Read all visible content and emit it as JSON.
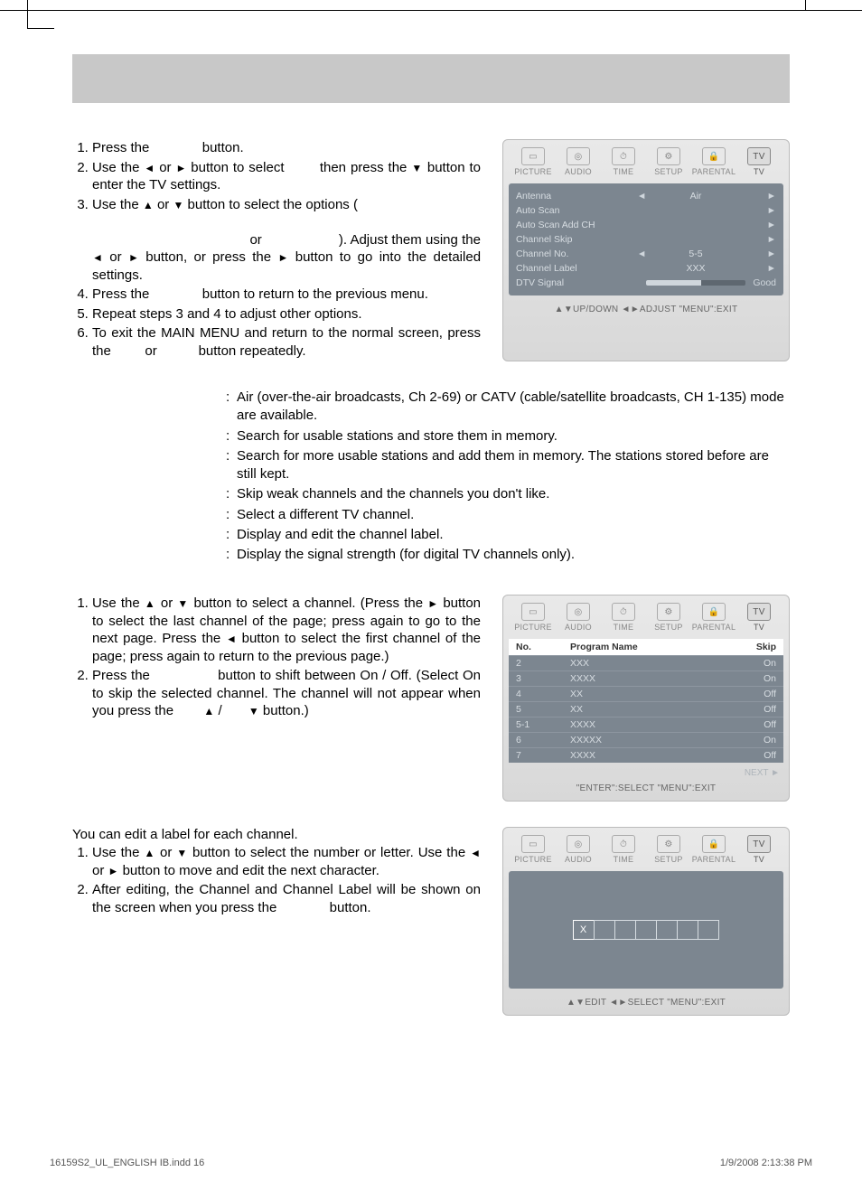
{
  "steps_a": {
    "s1a": "Press the",
    "s1b": "button.",
    "s2a": "Use the",
    "s2b": "or",
    "s2c": "button to select",
    "s2d": "then press the",
    "s2e": "button to enter the TV settings.",
    "s3a": "Use the",
    "s3b": "or",
    "s3c": "button to select the options (",
    "s3d": "or",
    "s3e": "). Adjust them using the",
    "s3f": "or",
    "s3g": "button, or press the",
    "s3h": "button to go into the detailed settings.",
    "s4a": "Press the",
    "s4b": "button to return to the previous menu.",
    "s5": "Repeat steps 3 and 4 to adjust other options.",
    "s6a": "To exit the MAIN MENU and return to the normal screen, press the",
    "s6b": "or",
    "s6c": "button repeatedly."
  },
  "osd1": {
    "tabs": [
      "PICTURE",
      "AUDIO",
      "TIME",
      "SETUP",
      "PARENTAL",
      "TV"
    ],
    "rows": [
      {
        "label": "Antenna",
        "left": "◄",
        "value": "Air",
        "right": "►"
      },
      {
        "label": "Auto Scan",
        "left": "",
        "value": "",
        "right": "►"
      },
      {
        "label": "Auto Scan Add CH",
        "left": "",
        "value": "",
        "right": "►"
      },
      {
        "label": "Channel Skip",
        "left": "",
        "value": "",
        "right": "►"
      },
      {
        "label": "Channel No.",
        "left": "◄",
        "value": "5-5",
        "right": "►"
      },
      {
        "label": "Channel Label",
        "left": "",
        "value": "XXX",
        "right": "►"
      },
      {
        "label": "DTV Signal",
        "left": "",
        "value": "__bar__",
        "right": "Good"
      }
    ],
    "foot": "▲▼UP/DOWN  ◄►ADJUST  \"MENU\":EXIT"
  },
  "defs": [
    "Air (over-the-air broadcasts, Ch 2-69) or CATV (cable/satellite broadcasts, CH 1-135) mode are available.",
    "Search for usable stations and store them in memory.",
    "Search for more usable stations and add them in memory. The stations stored before are still kept.",
    "Skip weak channels and the channels you don't like.",
    "Select a different TV channel.",
    "Display and edit the channel label.",
    "Display the signal strength (for digital TV channels only)."
  ],
  "steps_b": {
    "s1a": "Use the",
    "s1b": "or",
    "s1c": "button to select a channel. (Press the",
    "s1d": "button to select the last channel of the page; press again to go to the next page. Press the",
    "s1e": "button to select the first channel of the page; press again to return to the previous page.)",
    "s2a": "Press the",
    "s2b": "button to shift between On / Off. (Select On to skip the selected channel. The channel will not appear when you press the",
    "s2c": "/",
    "s2d": "button.)"
  },
  "osd2": {
    "hdr": {
      "no": "No.",
      "pn": "Program Name",
      "sk": "Skip"
    },
    "rows": [
      {
        "no": "2",
        "pn": "XXX",
        "sk": "On"
      },
      {
        "no": "3",
        "pn": "XXXX",
        "sk": "On"
      },
      {
        "no": "4",
        "pn": "XX",
        "sk": "Off"
      },
      {
        "no": "5",
        "pn": "XX",
        "sk": "Off"
      },
      {
        "no": "5-1",
        "pn": "XXXX",
        "sk": "Off"
      },
      {
        "no": "6",
        "pn": "XXXXX",
        "sk": "On"
      },
      {
        "no": "7",
        "pn": "XXXX",
        "sk": "Off"
      }
    ],
    "next": "NEXT ►",
    "foot": "\"ENTER\":SELECT  \"MENU\":EXIT"
  },
  "section_c": {
    "intro": "You can edit a label for each channel.",
    "s1a": "Use the",
    "s1b": "or",
    "s1c": "button to select the number or letter. Use the",
    "s1d": "or",
    "s1e": "button to move and edit the next character.",
    "s2a": "After editing, the Channel and Channel Label will be shown on the screen when you press the",
    "s2b": "button."
  },
  "osd3": {
    "cell0": "X",
    "foot": "▲▼EDIT  ◄►SELECT  \"MENU\":EXIT"
  },
  "footer": {
    "left": "16159S2_UL_ENGLISH IB.indd   16",
    "right": "1/9/2008   2:13:38 PM"
  }
}
